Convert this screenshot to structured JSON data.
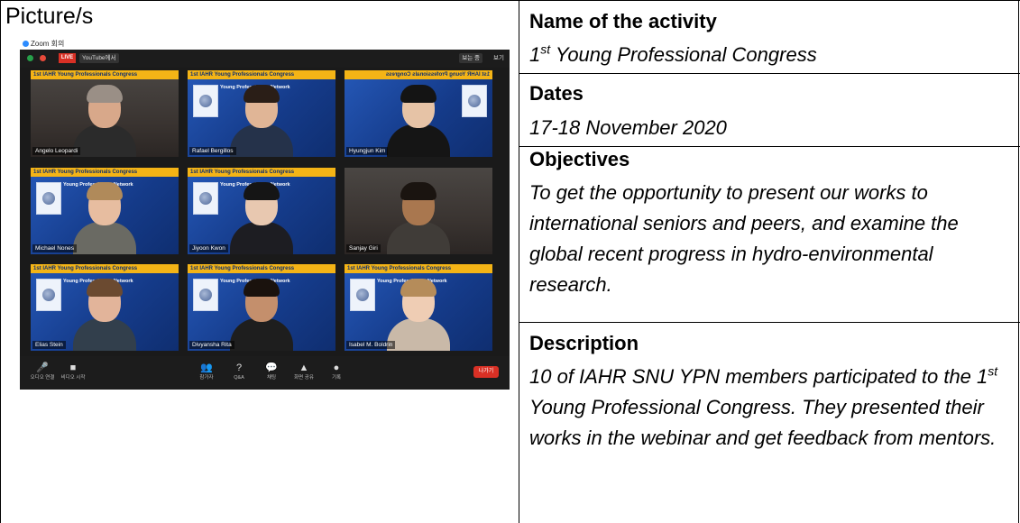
{
  "left_column": {
    "label": "Picture/s"
  },
  "screenshot": {
    "window_caption": "Zoom 회의",
    "toolbar": {
      "live_badge": "LIVE",
      "youtube_label": "YouTube에서",
      "status_label": "보는 중",
      "view_label": "보기"
    },
    "banner_text": "1st IAHR Young Professionals Congress",
    "ypn_text": "Young Professionals Network",
    "logo_text": "IAHR",
    "participants": [
      {
        "name": "Angelo Leopardi",
        "skin": "#d8a88a",
        "shirt": "#2b2b2b",
        "hair": "#9a8f86",
        "bg": "room"
      },
      {
        "name": "Rafael Bergillos",
        "skin": "#e0b596",
        "shirt": "#25324a",
        "hair": "#2a1e17",
        "bg": "ypn"
      },
      {
        "name": "Hyungjun Kim",
        "skin": "#e6c3a6",
        "shirt": "#151515",
        "hair": "#141414",
        "bg": "ypn-mirror"
      },
      {
        "name": "Michael Nones",
        "skin": "#e7bda0",
        "shirt": "#6a6a63",
        "hair": "#b08a5a",
        "bg": "ypn"
      },
      {
        "name": "Jiyoon Kwon",
        "skin": "#e8c8b0",
        "shirt": "#1d1d22",
        "hair": "#151515",
        "bg": "ypn"
      },
      {
        "name": "Sanjay Giri",
        "skin": "#a9774f",
        "shirt": "#403c38",
        "hair": "#1a1410",
        "bg": "room"
      },
      {
        "name": "Elias Stein",
        "skin": "#e2b49a",
        "shirt": "#323f4c",
        "hair": "#6b4a30",
        "bg": "ypn"
      },
      {
        "name": "Divyansha Rita",
        "skin": "#c48f6c",
        "shirt": "#1e1e1e",
        "hair": "#1a120d",
        "bg": "ypn"
      },
      {
        "name": "Isabel M. Boldrin",
        "skin": "#efcdb4",
        "shirt": "#c9b9a8",
        "hair": "#b58c5a",
        "bg": "ypn"
      }
    ],
    "controls": [
      {
        "icon": "🎤",
        "label": "오디오 연결"
      },
      {
        "icon": "■",
        "label": "비디오 시작"
      },
      {
        "icon": "👥",
        "label": "참가자"
      },
      {
        "icon": "?",
        "label": "Q&A"
      },
      {
        "icon": "💬",
        "label": "채팅"
      },
      {
        "icon": "▲",
        "label": "화면 공유"
      },
      {
        "icon": "●",
        "label": "기록"
      }
    ],
    "leave_label": "나가기"
  },
  "right_column": {
    "activity_heading": "Name of the activity",
    "activity_prefix": "1",
    "activity_sup": "st",
    "activity_rest": " Young Professional Congress",
    "dates_heading": "Dates",
    "dates_value": "17-18 November 2020",
    "objectives_heading": "Objectives",
    "objectives_value": "To get the opportunity to present our works to international seniors and peers, and examine the global recent progress in hydro-environmental research.",
    "description_heading": "Description",
    "description_part1": "10 of IAHR SNU YPN members participated to the 1",
    "description_sup": "st",
    "description_part2": " Young Professional Congress. They presented their works in the webinar and get feedback from mentors."
  }
}
